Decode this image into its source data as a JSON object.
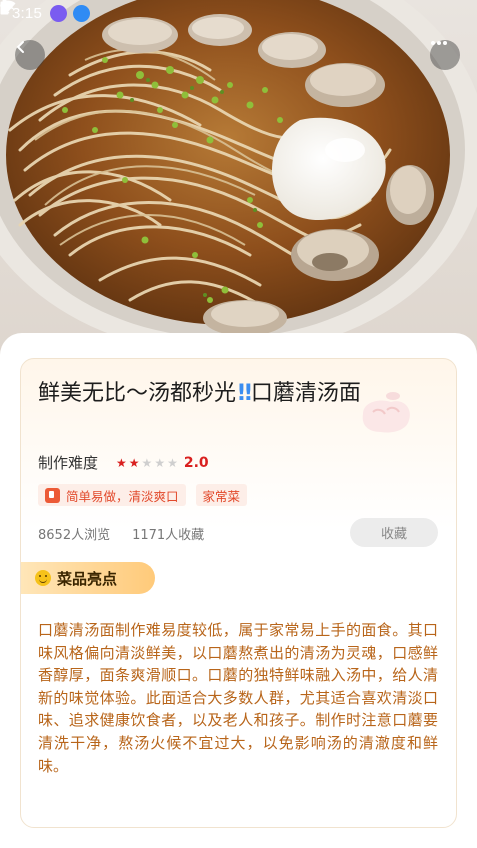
{
  "status_bar": {
    "time": "3:15",
    "notifications": [
      "moon-app-icon",
      "download-icon"
    ],
    "right_icons": [
      "wifi-icon",
      "airplane-icon",
      "battery-icon"
    ]
  },
  "nav": {
    "back_icon": "chevron-left-icon",
    "more_icon": "more-dots-icon"
  },
  "recipe": {
    "title_part1": "鲜美无比～汤都秒光",
    "title_emoji": "‼",
    "title_part2": "口蘑清汤面",
    "difficulty_label": "制作难度",
    "difficulty_score": "2.0",
    "difficulty_stars": 2,
    "difficulty_max": 5,
    "tags": [
      "简单易做，清淡爽口",
      "家常菜"
    ],
    "views": "8652人浏览",
    "favorites": "1171人收藏",
    "collect_button": "收藏"
  },
  "highlight": {
    "title": "菜品亮点",
    "description": "口蘑清汤面制作难易度较低，属于家常易上手的面食。其口味风格偏向清淡鲜美，以口蘑熬煮出的清汤为灵魂，口感鲜香醇厚，面条爽滑顺口。口蘑的独特鲜味融入汤中，给人清新的味觉体验。此面适合大多数人群，尤其适合喜欢清淡口味、追求健康饮食者，以及老人和孩子。制作时注意口蘑要清洗干净，熬汤火候不宜过大，以免影响汤的清澈度和鲜味。"
  },
  "colors": {
    "accent": "#e24a2c",
    "star_active": "#d9201f",
    "star_inactive": "#cfcfcf",
    "description_text": "#b8651a",
    "badge_gradient_end": "#ffca7a"
  }
}
